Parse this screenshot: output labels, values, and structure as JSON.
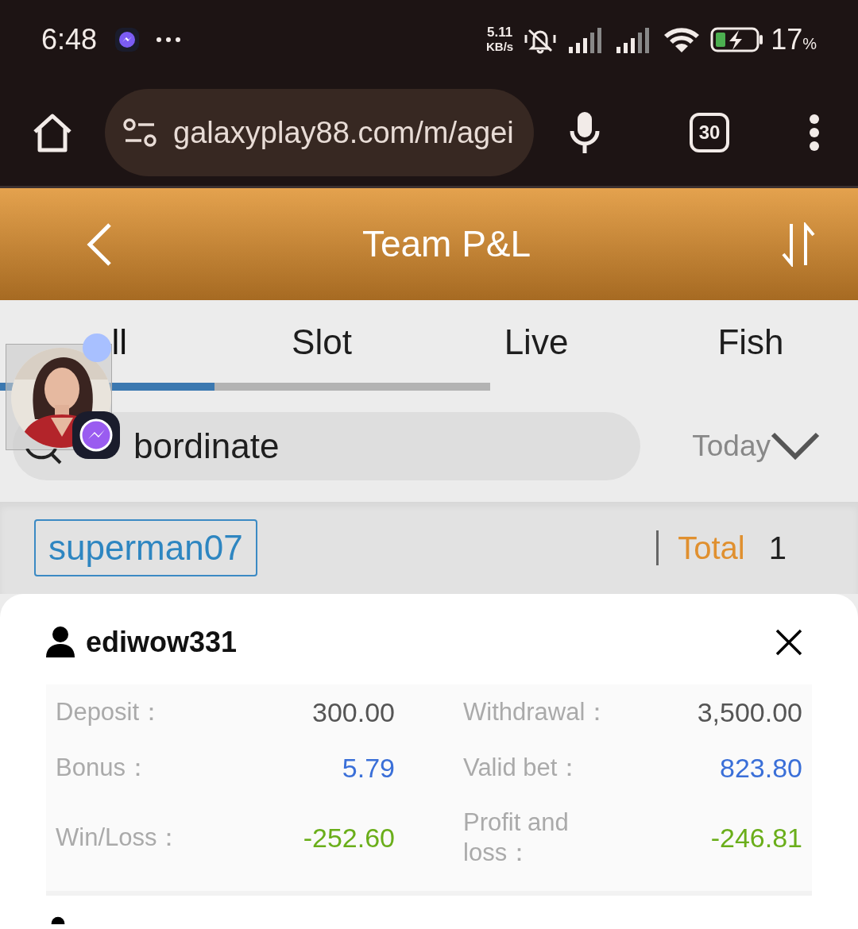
{
  "status_bar": {
    "time": "6:48",
    "speed_value": "5.11",
    "speed_unit": "KB/s",
    "battery": "17",
    "battery_unit": "%"
  },
  "browser": {
    "url": "galaxyplay88.com/m/agei",
    "tab_count": "30"
  },
  "header": {
    "title": "Team P&L"
  },
  "tabs": [
    {
      "label": "ll",
      "selected": true
    },
    {
      "label": "Slot",
      "selected": false
    },
    {
      "label": "Live",
      "selected": false
    },
    {
      "label": "Fish",
      "selected": false
    }
  ],
  "search": {
    "placeholder": "bordinate"
  },
  "period": {
    "value": "Today"
  },
  "filter": {
    "agent": "superman07",
    "total_label": "Total",
    "total_value": "1"
  },
  "records": [
    {
      "user": "ediwow331",
      "rows": [
        {
          "cells": [
            {
              "label": "Deposit：",
              "value": "300.00",
              "color": "#555555"
            },
            {
              "label": "Withdrawal：",
              "value": "3,500.00",
              "color": "#555555"
            }
          ]
        },
        {
          "cells": [
            {
              "label": "Bonus：",
              "value": "5.79",
              "color": "#3a6fd8"
            },
            {
              "label": "Valid bet：",
              "value": "823.80",
              "color": "#3a6fd8"
            }
          ]
        },
        {
          "cells": [
            {
              "label": "Win/Loss：",
              "value": "-252.60",
              "color": "#6aae1a"
            },
            {
              "label": "Profit and loss：",
              "value": "-246.81",
              "color": "#6aae1a"
            }
          ]
        }
      ]
    }
  ]
}
